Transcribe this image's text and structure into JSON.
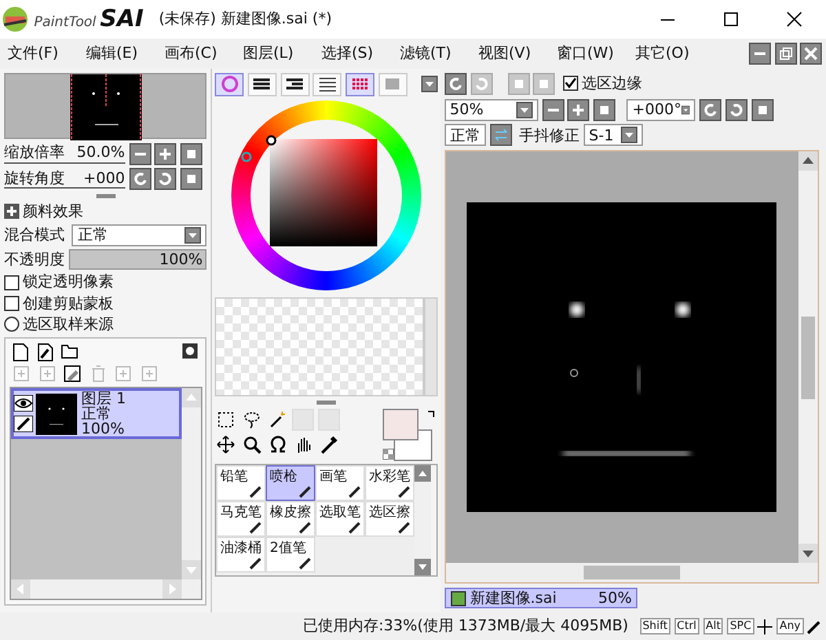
{
  "title_bar": {
    "logo_small": "PaintTool",
    "logo_big": "SAI",
    "title": "(未保存) 新建图像.sai (*)"
  },
  "menu": [
    "文件(F)",
    "编辑(E)",
    "画布(C)",
    "图层(L)",
    "选择(S)",
    "滤镜(T)",
    "视图(V)",
    "窗口(W)",
    "其它(O)"
  ],
  "navigator": {
    "zoom_label": "缩放倍率",
    "zoom_value": "50.0%",
    "rotate_label": "旋转角度",
    "rotate_value": "+000"
  },
  "paint_effect": {
    "label": "颜料效果"
  },
  "blend_mode": {
    "label": "混合模式",
    "value": "正常"
  },
  "opacity": {
    "label": "不透明度",
    "value": "100%",
    "level": 1
  },
  "options": [
    {
      "kind": "checkbox",
      "label": "锁定透明像素",
      "checked": false
    },
    {
      "kind": "checkbox",
      "label": "创建剪贴蒙板",
      "checked": false
    },
    {
      "kind": "radio",
      "label": "选区取样来源",
      "checked": false
    }
  ],
  "layers": [
    {
      "name": "图层 1",
      "mode": "正常",
      "opacity": "100%",
      "selected": true
    }
  ],
  "color_tabs": [
    {
      "selected": true
    },
    {
      "selected": false
    },
    {
      "selected": false
    },
    {
      "selected": false
    },
    {
      "selected": true
    },
    {
      "selected": false
    }
  ],
  "brushes": [
    {
      "label": "铅笔",
      "selected": false
    },
    {
      "label": "喷枪",
      "selected": true
    },
    {
      "label": "画笔",
      "selected": false
    },
    {
      "label": "水彩笔",
      "selected": false
    },
    {
      "label": "马克笔",
      "selected": false
    },
    {
      "label": "橡皮擦",
      "selected": false
    },
    {
      "label": "选取笔",
      "selected": false
    },
    {
      "label": "选区擦",
      "selected": false
    },
    {
      "label": "油漆桶",
      "selected": false
    },
    {
      "label": "2值笔",
      "selected": false
    }
  ],
  "canvas_toolbar": {
    "selection_edge": {
      "label": "选区边缘",
      "checked": true
    },
    "zoom": "50%",
    "angle": "+000°",
    "mode": "正常",
    "stabilizer_label": "手抖修正",
    "stabilizer": "S-1"
  },
  "documents": [
    {
      "name": "新建图像.sai",
      "zoom": "50%",
      "selected": true
    }
  ],
  "status_bar": {
    "memory": "已使用内存:33%(使用 1373MB/最大 4095MB)",
    "keys": [
      "Shift",
      "Ctrl",
      "Alt",
      "SPC"
    ],
    "any": "Any"
  }
}
